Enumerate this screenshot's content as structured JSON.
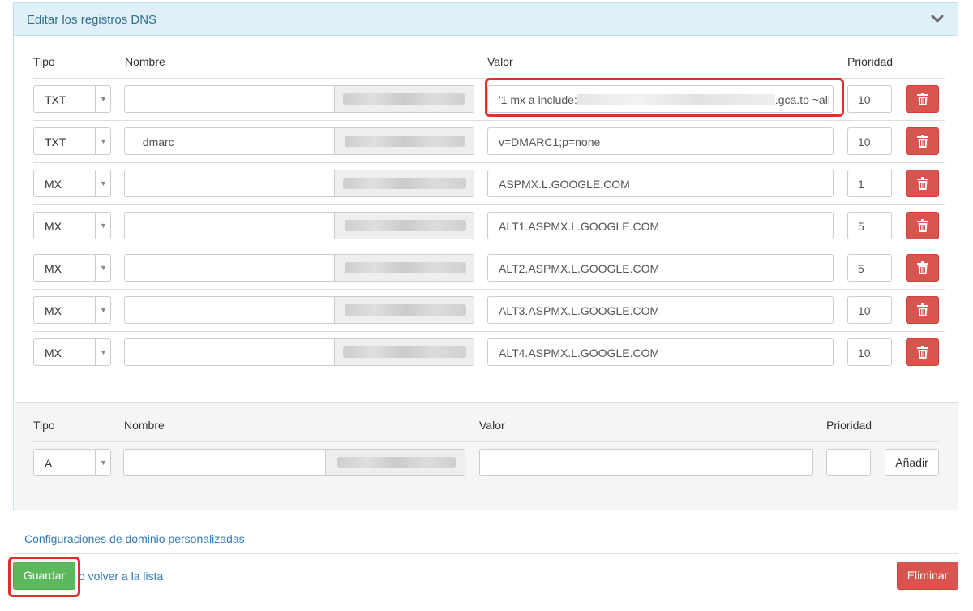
{
  "panel": {
    "title": "Editar los registros DNS",
    "toggle_icon": "chevron-down-icon"
  },
  "headers": {
    "tipo": "Tipo",
    "nombre": "Nombre",
    "valor": "Valor",
    "prioridad": "Prioridad"
  },
  "records": [
    {
      "tipo": "TXT",
      "nombre": "",
      "valor_prefix": "'1 mx a include:",
      "valor_suffix": ".gca.to ~all",
      "prioridad": "10"
    },
    {
      "tipo": "TXT",
      "nombre": "_dmarc",
      "valor": "v=DMARC1;p=none",
      "prioridad": "10"
    },
    {
      "tipo": "MX",
      "nombre": "",
      "valor": "ASPMX.L.GOOGLE.COM",
      "prioridad": "1"
    },
    {
      "tipo": "MX",
      "nombre": "",
      "valor": "ALT1.ASPMX.L.GOOGLE.COM",
      "prioridad": "5"
    },
    {
      "tipo": "MX",
      "nombre": "",
      "valor": "ALT2.ASPMX.L.GOOGLE.COM",
      "prioridad": "5"
    },
    {
      "tipo": "MX",
      "nombre": "",
      "valor": "ALT3.ASPMX.L.GOOGLE.COM",
      "prioridad": "10"
    },
    {
      "tipo": "MX",
      "nombre": "",
      "valor": "ALT4.ASPMX.L.GOOGLE.COM",
      "prioridad": "10"
    }
  ],
  "delete_icon": "trash-icon",
  "new_record": {
    "tipo": "A",
    "nombre": "",
    "valor": "",
    "prioridad": "",
    "add_label": "Añadir"
  },
  "footer": {
    "custom_domain_link": "Configuraciones de dominio personalizadas",
    "save_label": "Guardar",
    "back_link": "o volver a la lista",
    "delete_label": "Eliminar"
  },
  "colors": {
    "accent": "#31708f",
    "save": "#5cb85c",
    "danger": "#d9534f",
    "highlight": "#d9322b"
  }
}
